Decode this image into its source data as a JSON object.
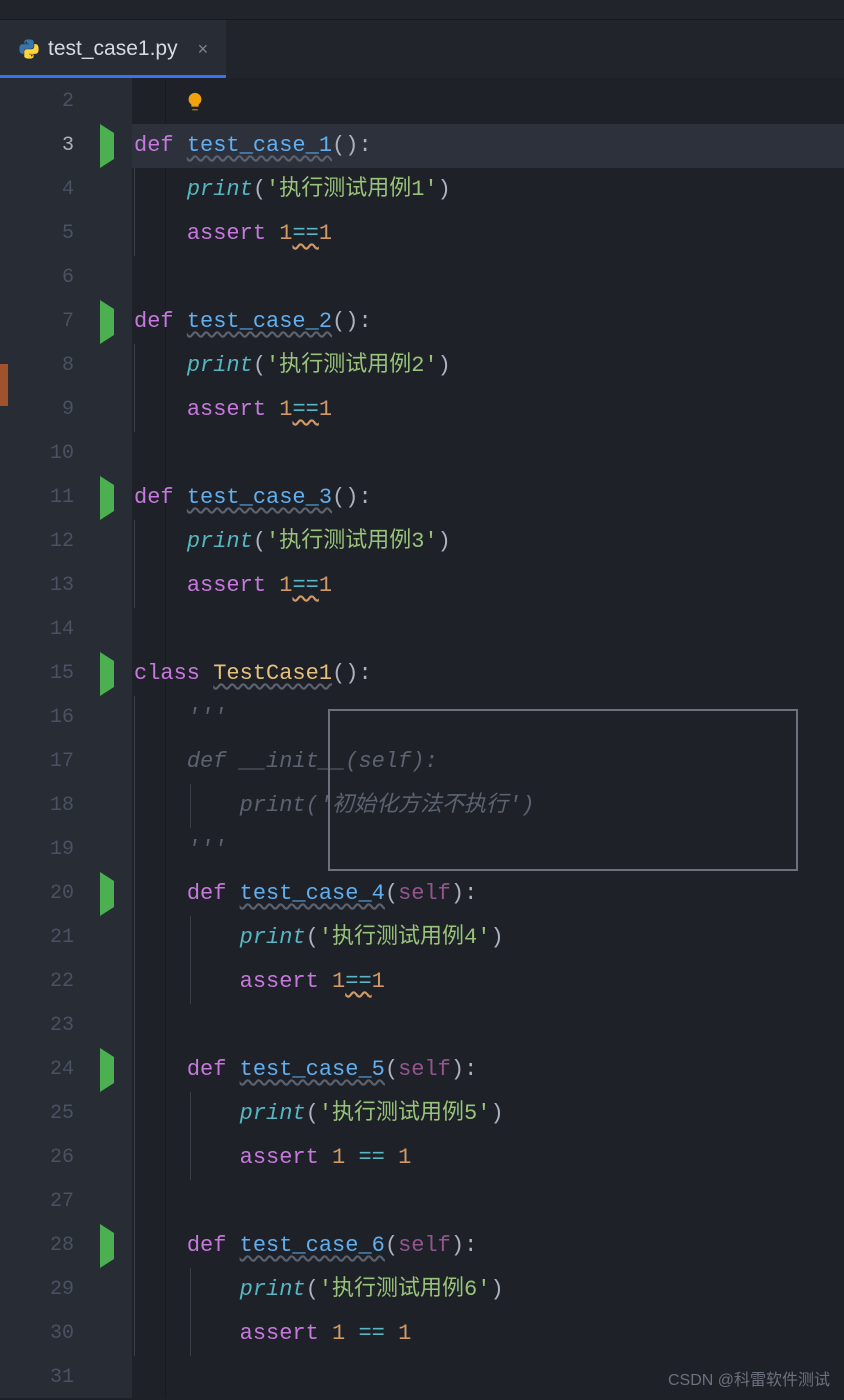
{
  "tab": {
    "filename": "test_case1.py",
    "close_glyph": "×"
  },
  "gutter": {
    "line_numbers": [
      "2",
      "3",
      "4",
      "5",
      "6",
      "7",
      "8",
      "9",
      "10",
      "11",
      "12",
      "13",
      "14",
      "15",
      "16",
      "17",
      "18",
      "19",
      "20",
      "21",
      "22",
      "23",
      "24",
      "25",
      "26",
      "27",
      "28",
      "29",
      "30",
      "31"
    ],
    "current_line": "3",
    "run_markers_at": [
      "3",
      "7",
      "11",
      "15",
      "20",
      "24",
      "28"
    ]
  },
  "code": {
    "l2": "",
    "l3_def": "def",
    "l3_fn": "test_case_1",
    "l4_print": "print",
    "l4_str": "'执行测试用例1'",
    "l5_assert": "assert",
    "l5_n1": "1",
    "l5_eq": "==",
    "l5_n2": "1",
    "l7_def": "def",
    "l7_fn": "test_case_2",
    "l8_print": "print",
    "l8_str": "'执行测试用例2'",
    "l9_assert": "assert",
    "l9_n1": "1",
    "l9_eq": "==",
    "l9_n2": "1",
    "l11_def": "def",
    "l11_fn": "test_case_3",
    "l12_print": "print",
    "l12_str": "'执行测试用例3'",
    "l13_assert": "assert",
    "l13_n1": "1",
    "l13_eq": "==",
    "l13_n2": "1",
    "l15_class": "class",
    "l15_name": "TestCase1",
    "l16_doc": "'''",
    "l17_c": "def __init__(self):",
    "l18_c": "    print('初始化方法不执行')",
    "l19_doc": "'''",
    "l20_def": "def",
    "l20_fn": "test_case_4",
    "l20_self": "self",
    "l21_print": "print",
    "l21_str": "'执行测试用例4'",
    "l22_assert": "assert",
    "l22_n1": "1",
    "l22_eq": "==",
    "l22_n2": "1",
    "l24_def": "def",
    "l24_fn": "test_case_5",
    "l24_self": "self",
    "l25_print": "print",
    "l25_str": "'执行测试用例5'",
    "l26_assert": "assert",
    "l26_n1": "1",
    "l26_n2": "1",
    "l28_def": "def",
    "l28_fn": "test_case_6",
    "l28_self": "self",
    "l29_print": "print",
    "l29_str": "'执行测试用例6'",
    "l30_assert": "assert",
    "l30_n1": "1",
    "l30_n2": "1"
  },
  "watermark": "CSDN @科雷软件测试"
}
